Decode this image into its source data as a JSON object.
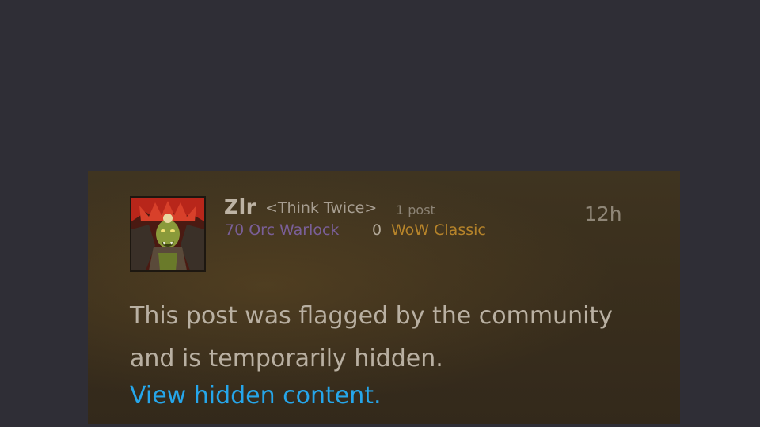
{
  "post": {
    "author": {
      "name": "Zlr",
      "guild": "<Think Twice>",
      "post_count": "1 post",
      "character": "70 Orc Warlock",
      "achievement_points": "0",
      "realm": "WoW Classic",
      "avatar_icon": "orc-warlock-avatar"
    },
    "timestamp": "12h",
    "flagged_message_line1": "This post was flagged by the community",
    "flagged_message_line2": "and is temporarily hidden.",
    "view_hidden_link": "View hidden content."
  },
  "colors": {
    "background": "#2f2e36",
    "post_background": "#3a2f1d",
    "warlock_class": "#7a5f98",
    "realm": "#b7842a",
    "link": "#26a6ea"
  }
}
